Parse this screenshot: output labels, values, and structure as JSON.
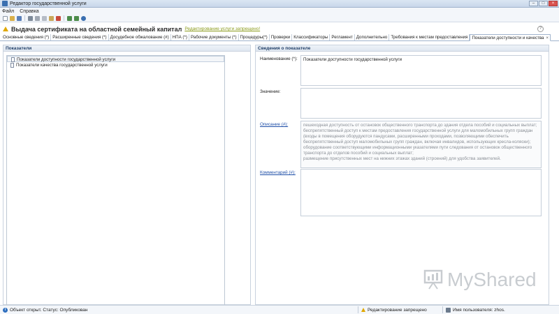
{
  "window": {
    "title": "Редактор государственной услуги"
  },
  "menu": [
    "Файл",
    "Справка"
  ],
  "toolbar": {
    "icons": [
      "new-icon",
      "open-icon",
      "save-icon",
      "print-icon",
      "cut-icon",
      "copy-icon",
      "paste-icon",
      "delete-icon",
      "up-icon",
      "down-icon",
      "help-icon"
    ]
  },
  "header": {
    "title": "Выдача сертификата на областной семейный капитал",
    "edit_link": "Редактирование услуги запрещено!"
  },
  "tabs": [
    "Основные сведения (*)",
    "Расширенные сведения (*)",
    "Досудебное обжалование (#)",
    "НПА (*)",
    "Рабочие документы (*)",
    "Процедуры(*)",
    "Проверки",
    "Классификаторы",
    "Регламент",
    "Дополнительно",
    "Требования к местам предоставления",
    "Показатели доступности и качества"
  ],
  "left_panel": {
    "title": "Показатели",
    "items": [
      "Показатели доступности государственной услуги",
      "Показатели качества государственной услуги"
    ]
  },
  "right_panel": {
    "title": "Сведения о показателе",
    "name_label": "Наименование (*):",
    "name_value": "Показатели доступности государственной услуги",
    "value_label": "Значение:",
    "description_label": "Описание (#):",
    "description_lines": [
      "пешеходная доступность от остановок общественного транспорта до здания отдела пособий и социальных выплат;",
      "беспрепятственный доступ к местам предоставления государственной услуги для маломобильных групп граждан",
      "(входы в помещения оборудуются пандусами, расширенными проходами, позволяющими обеспечить",
      "беспрепятственный доступ маломобильных групп граждан, включая инвалидов, использующих кресла-коляски);",
      "оборудование соответствующими информационными указателями пути следования от остановок общественного",
      "транспорта до отделов пособий и социальных выплат;",
      "размещение присутственных мест на нижних этажах зданий (строений) для удобства заявителей."
    ],
    "comment_label": "Комментарий (#):"
  },
  "status": {
    "object": "Объект открыт. Статус: Опубликован",
    "editing": "Редактирование запрещено",
    "user": "Имя пользователя: zhos."
  },
  "watermark": "MyShared"
}
